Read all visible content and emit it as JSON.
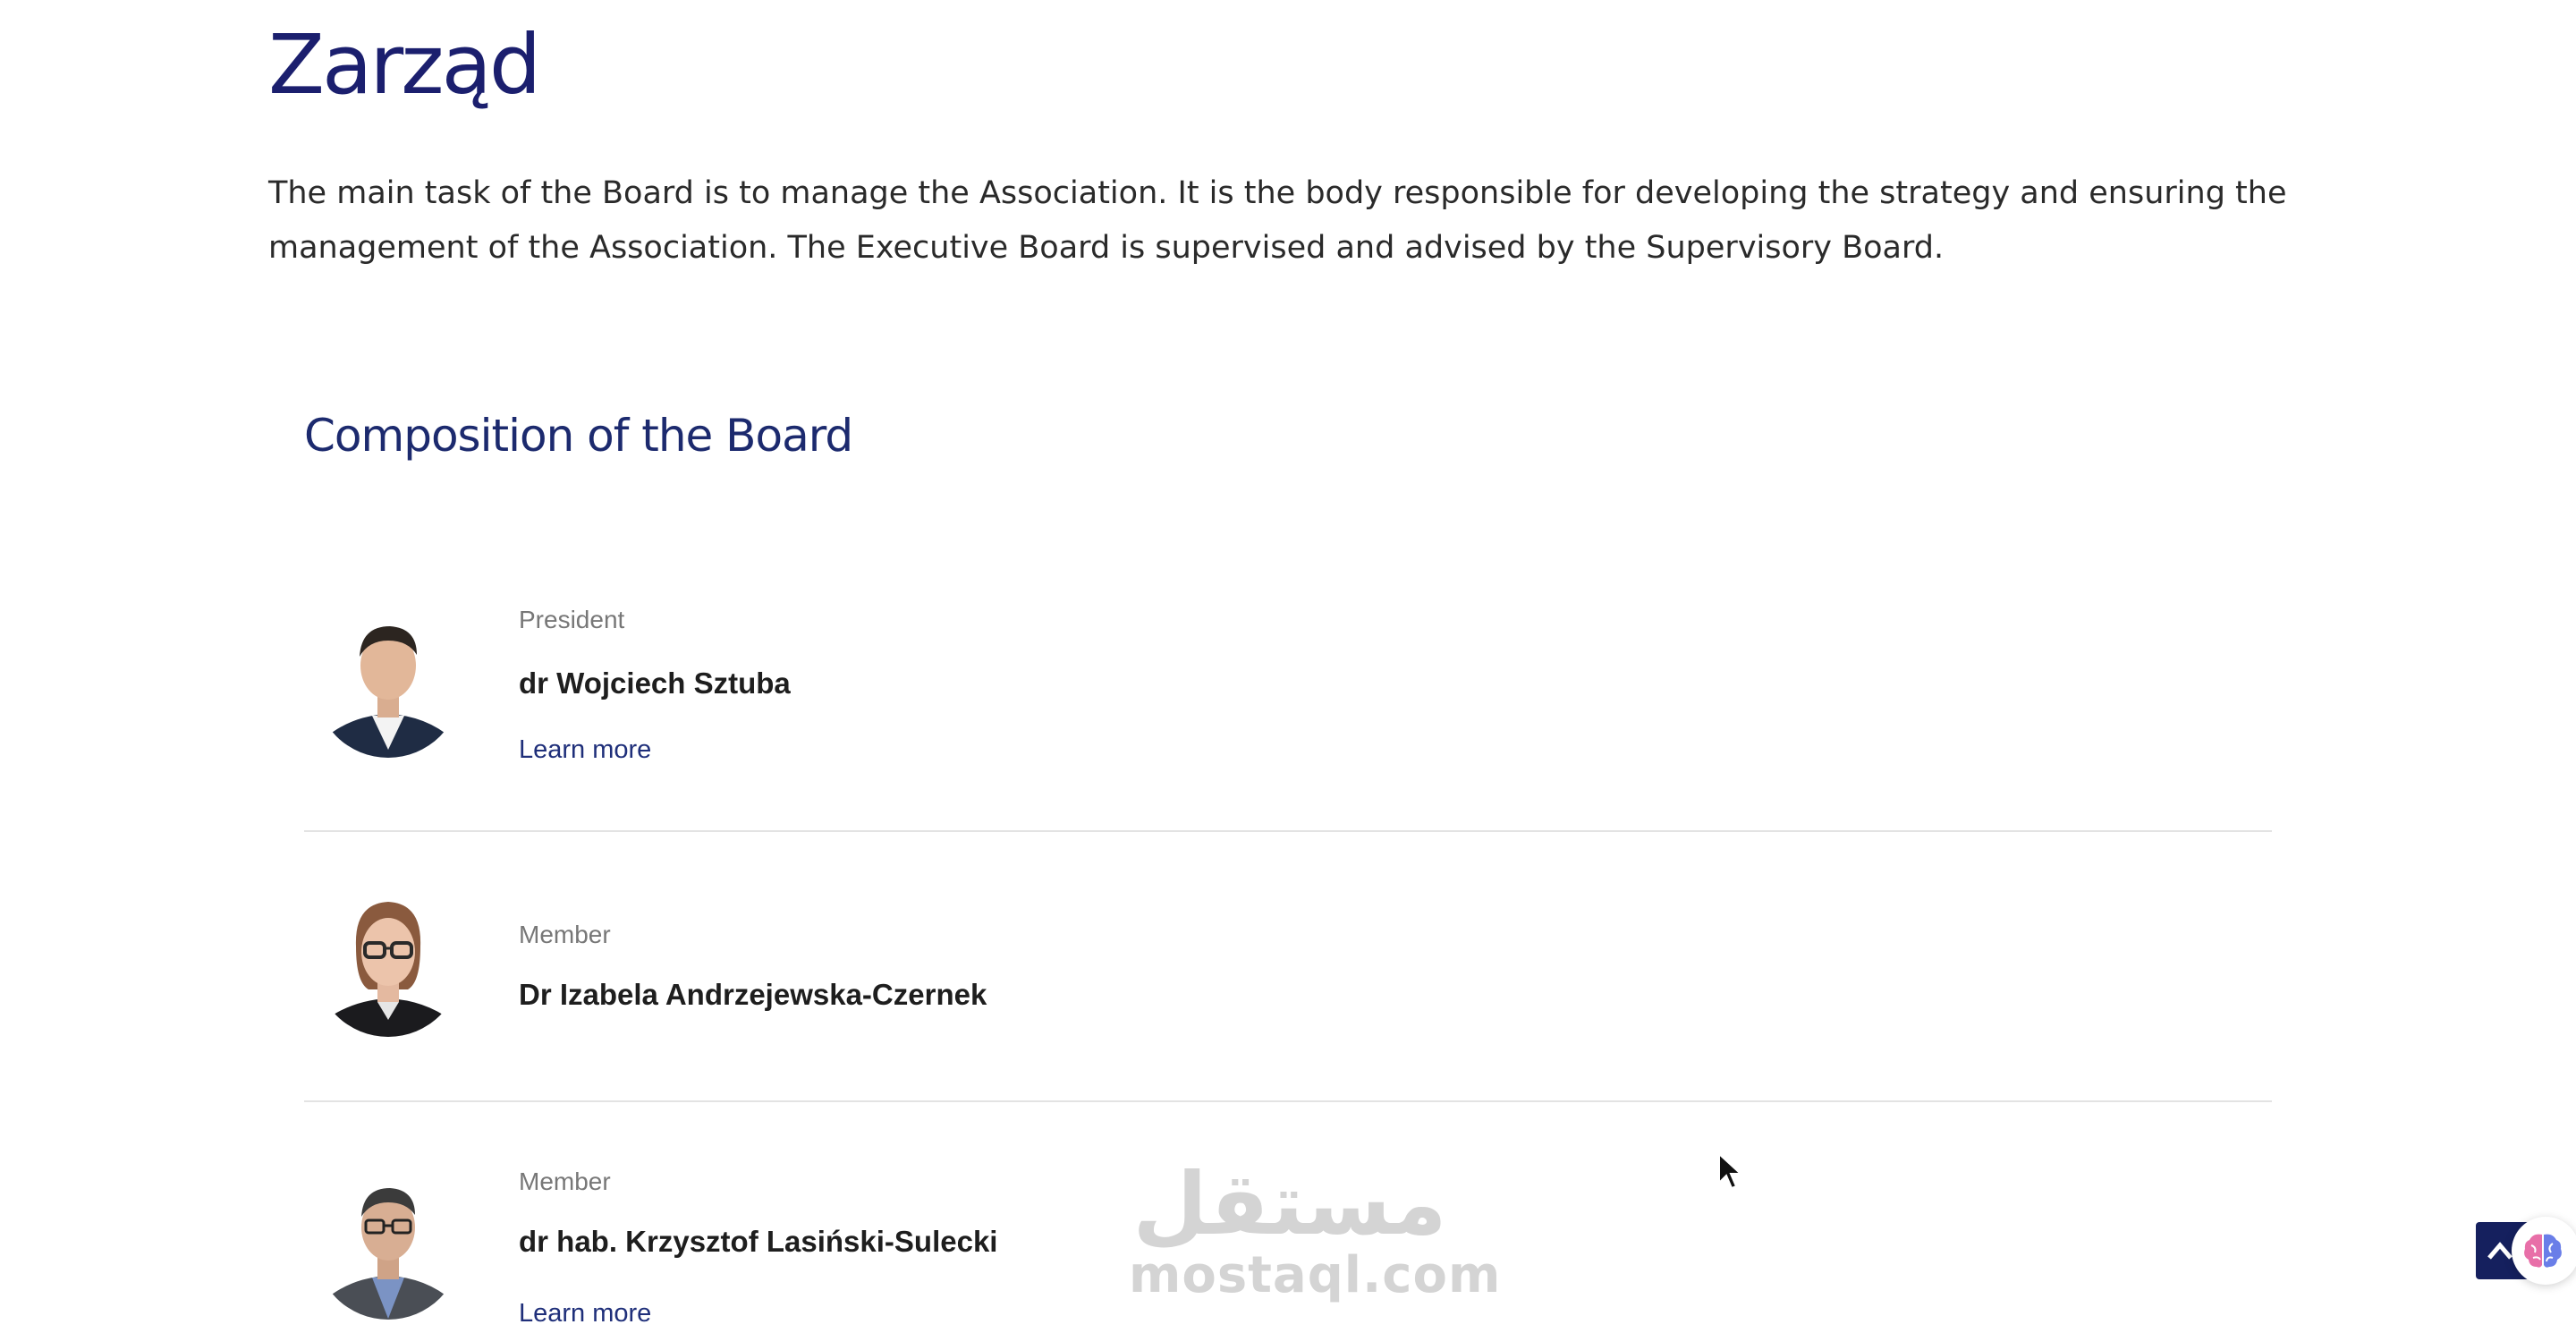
{
  "page": {
    "title": "Zarząd",
    "intro": "The main task of the Board is to manage the Association. It is the body responsible for developing the strategy and ensuring the management of the Association. The Executive Board is supervised and advised by the Supervisory Board."
  },
  "composition": {
    "heading": "Composition of the Board",
    "members": [
      {
        "role": "President",
        "name": "dr Wojciech Sztuba",
        "link_label": "Learn more"
      },
      {
        "role": "Member",
        "name": "Dr Izabela Andrzejewska-Czernek"
      },
      {
        "role": "Member",
        "name": "dr hab. Krzysztof Lasiński-Sulecki",
        "link_label": "Learn more"
      }
    ]
  },
  "watermark": {
    "logo_text": "مستقل",
    "domain": "mostaql.com"
  },
  "colors": {
    "heading": "#1b1f6e",
    "link": "#1f2f7a",
    "divider": "#e3e3e3",
    "scroll_button": "#15205e"
  },
  "icons": {
    "scroll_top": "chevron-up-icon",
    "helper": "brain-icon",
    "cursor": "mouse-pointer-icon"
  }
}
